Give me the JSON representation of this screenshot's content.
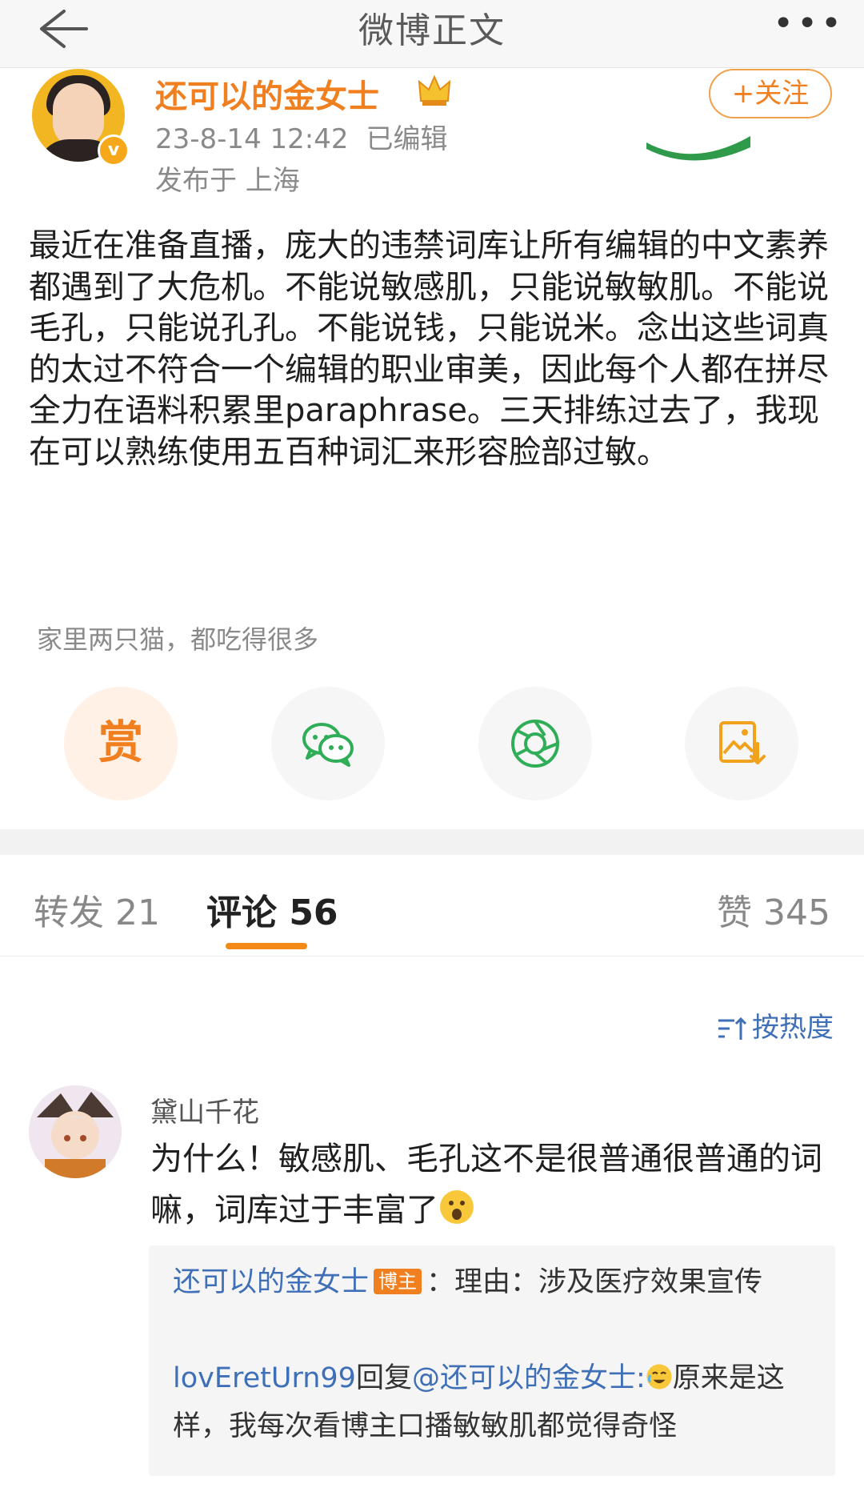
{
  "nav": {
    "title": "微博正文",
    "more": "•••"
  },
  "author": {
    "name": "还可以的金女士",
    "verified_badge": "v",
    "time": "23-8-14 12:42",
    "edited": "已编辑",
    "location": "发布于 上海",
    "follow_label": "+关注"
  },
  "post": {
    "text": "最近在准备直播，庞大的违禁词库让所有编辑的中文素养都遇到了大危机。不能说敏感肌，只能说敏敏肌。不能说毛孔，只能说孔孔。不能说钱，只能说米。念出这些词真的太过不符合一个编辑的职业审美，因此每个人都在拼尽全力在语料积累里paraphrase。三天排练过去了，我现在可以熟练使用五百种词汇来形容脸部过敏。",
    "tail": "家里两只猫，都吃得很多"
  },
  "actions": {
    "reward_label": "赏",
    "items": [
      "reward-icon",
      "wechat-icon",
      "moments-icon",
      "save-image-icon"
    ]
  },
  "tabs": [
    {
      "label": "转发 21"
    },
    {
      "label": "评论 56"
    },
    {
      "label": "赞 345"
    }
  ],
  "sort": {
    "label": "按热度"
  },
  "comment": {
    "user": "黛山千花",
    "text": "为什么！敏感肌、毛孔这不是很普通很普通的词嘛，词库过于丰富了",
    "replies": [
      {
        "user": "还可以的金女士",
        "tag": "博主",
        "text": "：理由：涉及医疗效果宣传"
      },
      {
        "user": "lovEretUrn99",
        "reply_word": "回复",
        "mention": "@还可以的金女士:",
        "text": "原来是这样，我每次看博主口播敏敏肌都觉得奇怪"
      }
    ]
  },
  "colors": {
    "accent": "#f07f20",
    "link": "#3f6fb6",
    "indicator": "#f38a18"
  }
}
